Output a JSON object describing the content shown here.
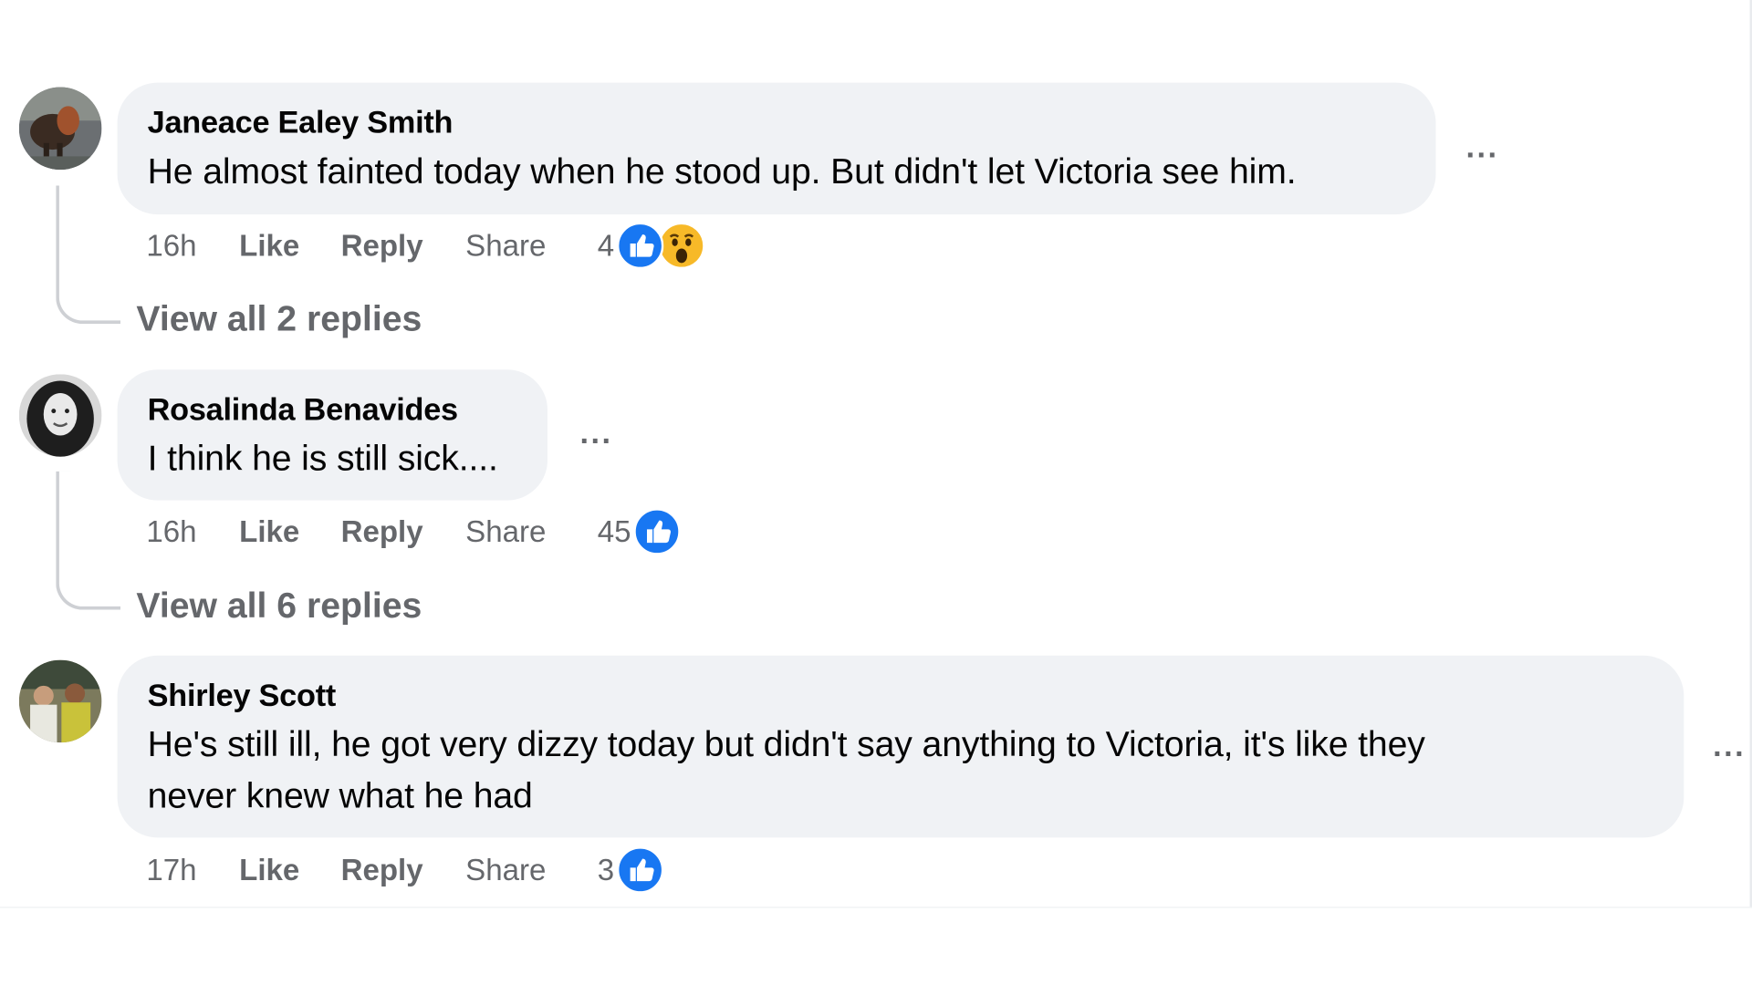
{
  "comments": [
    {
      "author": "Janeace Ealey Smith",
      "text_lines": [
        "He almost fainted today when he stood up. But didn't let Victoria see him."
      ],
      "time": "16h",
      "like_label": "Like",
      "reply_label": "Reply",
      "share_label": "Share",
      "reaction_count": "4",
      "reactions": [
        "like-icon",
        "wow-icon"
      ],
      "more_label": "...",
      "view_replies": "View all 2 replies"
    },
    {
      "author": "Rosalinda Benavides",
      "text_lines": [
        "I think he is still sick...."
      ],
      "time": "16h",
      "like_label": "Like",
      "reply_label": "Reply",
      "share_label": "Share",
      "reaction_count": "45",
      "reactions": [
        "like-icon"
      ],
      "more_label": "...",
      "view_replies": "View all 6 replies"
    },
    {
      "author": "Shirley Scott",
      "text_lines": [
        "He's still ill, he got very dizzy today but didn't say anything to Victoria, it's like they",
        "never knew what he had"
      ],
      "time": "17h",
      "like_label": "Like",
      "reply_label": "Reply",
      "share_label": "Share",
      "reaction_count": "3",
      "reactions": [
        "like-icon"
      ],
      "more_label": "..."
    }
  ],
  "colors": {
    "bubble": "#f0f2f5",
    "secondary_text": "#65676b",
    "like_blue": "#1877f2",
    "wow_yellow": "#f7b928"
  }
}
